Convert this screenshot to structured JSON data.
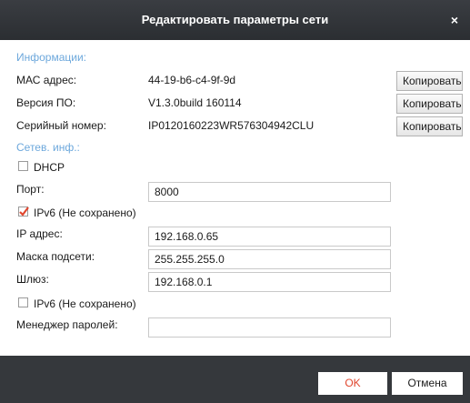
{
  "dialog": {
    "title": "Редактировать параметры сети",
    "close_icon": "×"
  },
  "info": {
    "header": "Информации:",
    "mac_label": "МАС адрес:",
    "mac_value": "44-19-b6-c4-9f-9d",
    "firmware_label": "Версия ПО:",
    "firmware_value": "V1.3.0build 160114",
    "serial_label": "Серийный номер:",
    "serial_value": "IP0120160223WR576304942CLU",
    "copy_label": "Копировать"
  },
  "network": {
    "header": "Сетев. инф.:",
    "dhcp_label": "DHCP",
    "dhcp_checked": false,
    "port_label": "Порт:",
    "port_value": "8000",
    "ipv6_saved_label": "IPv6 (Не сохранено)",
    "ipv6_saved_checked": true,
    "ip_label": "IP адрес:",
    "ip_value": "192.168.0.65",
    "mask_label": "Маска подсети:",
    "mask_value": "255.255.255.0",
    "gateway_label": "Шлюз:",
    "gateway_value": "192.168.0.1",
    "ipv6_unsaved_label": "IPv6 (Не сохранено)",
    "ipv6_unsaved_checked": false,
    "password_manager_label": "Менеджер паролей:",
    "password_manager_value": ""
  },
  "footer": {
    "ok_label": "OK",
    "cancel_label": "Отмена"
  },
  "colors": {
    "titlebar": "#2b2e32",
    "section_header": "#6da8dc",
    "ok_text": "#e0462e",
    "check_mark": "#e0462e"
  }
}
